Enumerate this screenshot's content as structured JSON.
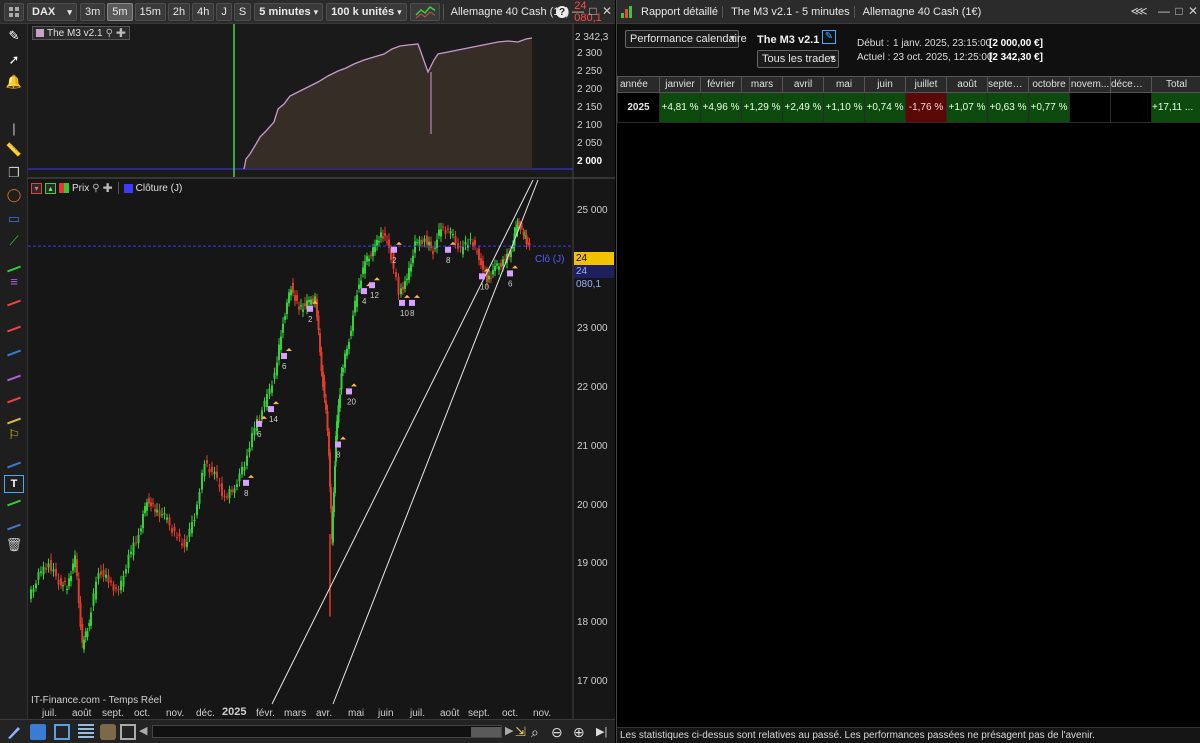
{
  "left": {
    "toolbar": {
      "instrument": "DAX",
      "timeframes": [
        "3m",
        "5m",
        "15m",
        "2h",
        "4h",
        "J",
        "S"
      ],
      "active_timeframe": "5m",
      "interval_select": "5 minutes",
      "units_select": "100 k unités",
      "market_label": "Allemagne 40 Cash (1€)",
      "price": "24 080,1"
    },
    "equity_panel": {
      "legend": "The M3 v2.1",
      "axis_labels": [
        "2 342,3",
        "2 300",
        "2 250",
        "2 200",
        "2 150",
        "2 100",
        "2 050",
        "2 000"
      ]
    },
    "price_panel": {
      "legend_prix": "Prix",
      "legend_close": "Clôture (J)",
      "axis_labels": [
        "25 000",
        "24 000",
        "23 000",
        "22 000",
        "21 000",
        "20 000",
        "19 000",
        "18 000",
        "17 000"
      ],
      "price_tag": "24 080,1",
      "price_tag2": "24 080,1",
      "close_label": "Clô (J)",
      "footer": "IT-Finance.com - Temps Réel",
      "months": [
        "juil.",
        "août",
        "sept.",
        "oct.",
        "nov.",
        "déc.",
        "2025",
        "févr.",
        "mars",
        "avr.",
        "mai",
        "juin",
        "juil.",
        "août",
        "sept.",
        "oct.",
        "nov."
      ],
      "trade_labels": [
        "8",
        "6",
        "14",
        "6",
        "2",
        "20",
        "8",
        "4",
        "12",
        "10",
        "8",
        "2",
        "8",
        "10",
        "6"
      ]
    },
    "tools": [
      "pencil-icon",
      "cursor-icon",
      "alarm-icon",
      "vertical-line-icon",
      "ruler-icon",
      "copy-icon",
      "ellipse-icon",
      "rectangle-icon",
      "trend-icon",
      "channel-icon",
      "fibonacci-icon",
      "text-icon",
      "delete-icon"
    ]
  },
  "right": {
    "title_tabs": [
      "Rapport détaillé",
      "The M3 v2.1 - 5 minutes",
      "Allemagne 40 Cash (1€)"
    ],
    "view_select": "Performance calendaire",
    "strategy_name": "The M3 v2.1",
    "trades_select": "Tous les trades",
    "start_label": "Début :",
    "start_value": "1 janv. 2025, 23:15:00",
    "start_amount": "[2 000,00 €]",
    "current_label": "Actuel :",
    "current_value": "23 oct. 2025, 12:25:00",
    "current_amount": "[2 342,30 €]",
    "table": {
      "headers": [
        "année",
        "janvier",
        "février",
        "mars",
        "avril",
        "mai",
        "juin",
        "juillet",
        "août",
        "septem...",
        "octobre",
        "novem...",
        "décemb...",
        "Total"
      ],
      "rows": [
        {
          "year": "2025",
          "values": [
            "+4,81 %",
            "+4,96 %",
            "+1,29 %",
            "+2,49 %",
            "+1,10 %",
            "+0,74 %",
            "-1,76 %",
            "+1,07 %",
            "+0,63 %",
            "+0,77 %",
            "",
            "",
            "+17,11 ..."
          ]
        }
      ]
    },
    "disclaimer": "Les statistiques ci-dessus sont relatives au passé. Les performances passées ne présagent pas de l'avenir.",
    "colors": {
      "positive": "#0d4a0d",
      "negative": "#5a0808"
    }
  }
}
